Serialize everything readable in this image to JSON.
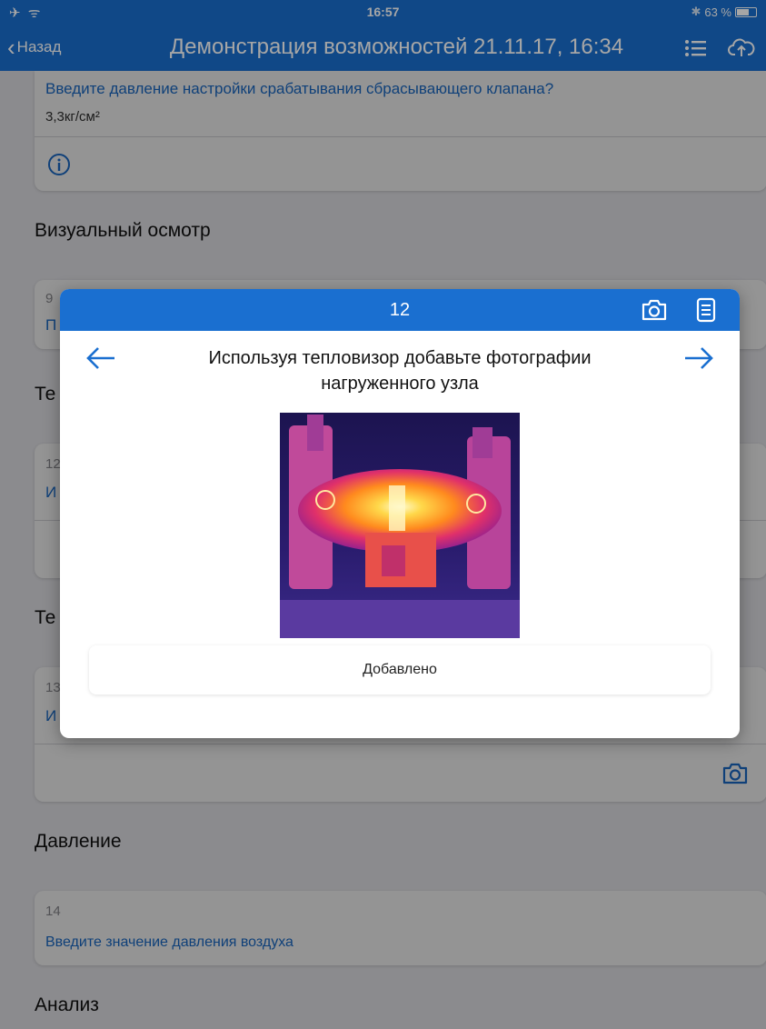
{
  "status_bar": {
    "left_icons": "✈ ᯤ",
    "time": "16:57",
    "battery_text": "63 %",
    "battery_level": 0.63
  },
  "nav": {
    "back_label": "Назад",
    "title": "Демонстрация возможностей 21.11.17, 16:34"
  },
  "background": {
    "card1": {
      "question": "Введите давление настройки срабатывания сбрасывающего клапана?",
      "value": "3,3кг/см²"
    },
    "section_visual": "Визуальный осмотр",
    "peek_num_9": "9",
    "peek_link_p": "П",
    "peek_section_te1": "Те",
    "peek_num_12": "12",
    "peek_link_i1": "И",
    "peek_section_te2": "Те",
    "peek_num_13": "13",
    "peek_link_i2": "И",
    "section_pressure": "Давление",
    "card14": {
      "num": "14",
      "link": "Введите значение давления воздуха"
    },
    "section_analysis": "Анализ"
  },
  "modal": {
    "counter": "12",
    "question": "Используя тепловизор добавьте фотографии нагруженного узла",
    "status_button": "Добавлено"
  },
  "colors": {
    "accent": "#1a6fd0"
  }
}
